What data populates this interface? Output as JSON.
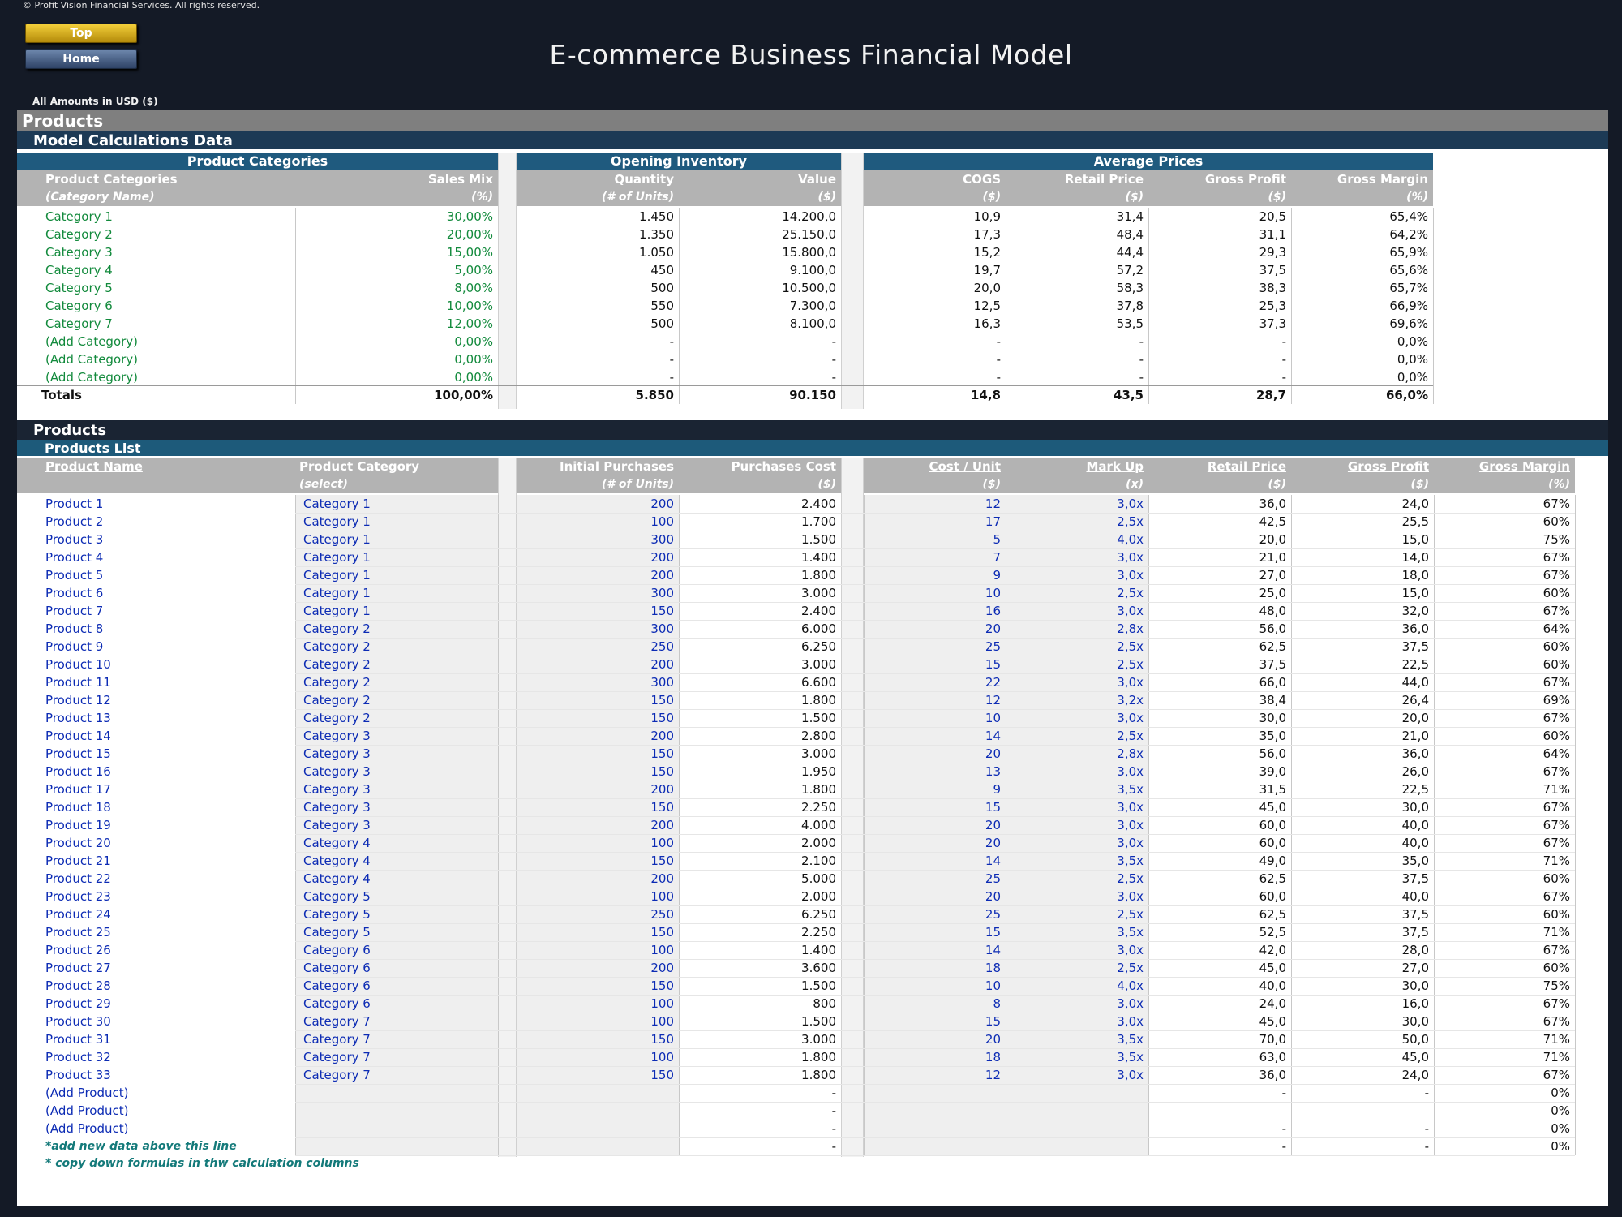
{
  "copyright": "© Profit Vision Financial Services. All rights reserved.",
  "nav": {
    "top_label": "Top",
    "home_label": "Home"
  },
  "page_title": "E-commerce Business Financial Model",
  "currency_note": "All Amounts in  USD ($)",
  "bands": {
    "products": "Products",
    "model_calc": "Model Calculations Data",
    "products2": "Products",
    "products_list": "Products List"
  },
  "calc_table": {
    "groups": [
      "Product Categories",
      "Opening Inventory",
      "Average Prices"
    ],
    "headers": [
      {
        "h1": "Product Categories",
        "h2": "(Category Name)"
      },
      {
        "h1": "Sales Mix",
        "h2": "(%)"
      },
      {
        "h1": "Quantity",
        "h2": "(# of Units)"
      },
      {
        "h1": "Value",
        "h2": "($)"
      },
      {
        "h1": "COGS",
        "h2": "($)"
      },
      {
        "h1": "Retail Price",
        "h2": "($)"
      },
      {
        "h1": "Gross Profit",
        "h2": "($)"
      },
      {
        "h1": "Gross Margin",
        "h2": "(%)"
      }
    ],
    "rows": [
      [
        "Category 1",
        "30,00%",
        "1.450",
        "14.200,0",
        "10,9",
        "31,4",
        "20,5",
        "65,4%"
      ],
      [
        "Category 2",
        "20,00%",
        "1.350",
        "25.150,0",
        "17,3",
        "48,4",
        "31,1",
        "64,2%"
      ],
      [
        "Category 3",
        "15,00%",
        "1.050",
        "15.800,0",
        "15,2",
        "44,4",
        "29,3",
        "65,9%"
      ],
      [
        "Category 4",
        "5,00%",
        "450",
        "9.100,0",
        "19,7",
        "57,2",
        "37,5",
        "65,6%"
      ],
      [
        "Category 5",
        "8,00%",
        "500",
        "10.500,0",
        "20,0",
        "58,3",
        "38,3",
        "65,7%"
      ],
      [
        "Category 6",
        "10,00%",
        "550",
        "7.300,0",
        "12,5",
        "37,8",
        "25,3",
        "66,9%"
      ],
      [
        "Category 7",
        "12,00%",
        "500",
        "8.100,0",
        "16,3",
        "53,5",
        "37,3",
        "69,6%"
      ],
      [
        "(Add Category)",
        "0,00%",
        "-",
        "-",
        "-",
        "-",
        "-",
        "0,0%"
      ],
      [
        "(Add Category)",
        "0,00%",
        "-",
        "-",
        "-",
        "-",
        "-",
        "0,0%"
      ],
      [
        "(Add Category)",
        "0,00%",
        "-",
        "-",
        "-",
        "-",
        "-",
        "0,0%"
      ]
    ],
    "totals": [
      "Totals",
      "100,00%",
      "5.850",
      "90.150",
      "14,8",
      "43,5",
      "28,7",
      "66,0%"
    ]
  },
  "products_table": {
    "headers": [
      {
        "h1": "Product Name",
        "h2": ""
      },
      {
        "h1": "Product Category",
        "h2": "(select)"
      },
      {
        "h1": "Initial Purchases",
        "h2": "(# of Units)"
      },
      {
        "h1": "Purchases Cost",
        "h2": "($)"
      },
      {
        "h1": "Cost / Unit",
        "h2": "($)"
      },
      {
        "h1": "Mark Up",
        "h2": "(x)"
      },
      {
        "h1": "Retail Price",
        "h2": "($)"
      },
      {
        "h1": "Gross Profit",
        "h2": "($)"
      },
      {
        "h1": "Gross Margin",
        "h2": "(%)"
      }
    ],
    "rows": [
      [
        "Product 1",
        "Category 1",
        "200",
        "2.400",
        "12",
        "3,0x",
        "36,0",
        "24,0",
        "67%"
      ],
      [
        "Product 2",
        "Category 1",
        "100",
        "1.700",
        "17",
        "2,5x",
        "42,5",
        "25,5",
        "60%"
      ],
      [
        "Product 3",
        "Category 1",
        "300",
        "1.500",
        "5",
        "4,0x",
        "20,0",
        "15,0",
        "75%"
      ],
      [
        "Product 4",
        "Category 1",
        "200",
        "1.400",
        "7",
        "3,0x",
        "21,0",
        "14,0",
        "67%"
      ],
      [
        "Product 5",
        "Category 1",
        "200",
        "1.800",
        "9",
        "3,0x",
        "27,0",
        "18,0",
        "67%"
      ],
      [
        "Product 6",
        "Category 1",
        "300",
        "3.000",
        "10",
        "2,5x",
        "25,0",
        "15,0",
        "60%"
      ],
      [
        "Product 7",
        "Category 1",
        "150",
        "2.400",
        "16",
        "3,0x",
        "48,0",
        "32,0",
        "67%"
      ],
      [
        "Product 8",
        "Category 2",
        "300",
        "6.000",
        "20",
        "2,8x",
        "56,0",
        "36,0",
        "64%"
      ],
      [
        "Product 9",
        "Category 2",
        "250",
        "6.250",
        "25",
        "2,5x",
        "62,5",
        "37,5",
        "60%"
      ],
      [
        "Product 10",
        "Category 2",
        "200",
        "3.000",
        "15",
        "2,5x",
        "37,5",
        "22,5",
        "60%"
      ],
      [
        "Product 11",
        "Category 2",
        "300",
        "6.600",
        "22",
        "3,0x",
        "66,0",
        "44,0",
        "67%"
      ],
      [
        "Product 12",
        "Category 2",
        "150",
        "1.800",
        "12",
        "3,2x",
        "38,4",
        "26,4",
        "69%"
      ],
      [
        "Product 13",
        "Category 2",
        "150",
        "1.500",
        "10",
        "3,0x",
        "30,0",
        "20,0",
        "67%"
      ],
      [
        "Product 14",
        "Category 3",
        "200",
        "2.800",
        "14",
        "2,5x",
        "35,0",
        "21,0",
        "60%"
      ],
      [
        "Product 15",
        "Category 3",
        "150",
        "3.000",
        "20",
        "2,8x",
        "56,0",
        "36,0",
        "64%"
      ],
      [
        "Product 16",
        "Category 3",
        "150",
        "1.950",
        "13",
        "3,0x",
        "39,0",
        "26,0",
        "67%"
      ],
      [
        "Product 17",
        "Category 3",
        "200",
        "1.800",
        "9",
        "3,5x",
        "31,5",
        "22,5",
        "71%"
      ],
      [
        "Product 18",
        "Category 3",
        "150",
        "2.250",
        "15",
        "3,0x",
        "45,0",
        "30,0",
        "67%"
      ],
      [
        "Product 19",
        "Category 3",
        "200",
        "4.000",
        "20",
        "3,0x",
        "60,0",
        "40,0",
        "67%"
      ],
      [
        "Product 20",
        "Category 4",
        "100",
        "2.000",
        "20",
        "3,0x",
        "60,0",
        "40,0",
        "67%"
      ],
      [
        "Product 21",
        "Category 4",
        "150",
        "2.100",
        "14",
        "3,5x",
        "49,0",
        "35,0",
        "71%"
      ],
      [
        "Product 22",
        "Category 4",
        "200",
        "5.000",
        "25",
        "2,5x",
        "62,5",
        "37,5",
        "60%"
      ],
      [
        "Product 23",
        "Category 5",
        "100",
        "2.000",
        "20",
        "3,0x",
        "60,0",
        "40,0",
        "67%"
      ],
      [
        "Product 24",
        "Category 5",
        "250",
        "6.250",
        "25",
        "2,5x",
        "62,5",
        "37,5",
        "60%"
      ],
      [
        "Product 25",
        "Category 5",
        "150",
        "2.250",
        "15",
        "3,5x",
        "52,5",
        "37,5",
        "71%"
      ],
      [
        "Product 26",
        "Category 6",
        "100",
        "1.400",
        "14",
        "3,0x",
        "42,0",
        "28,0",
        "67%"
      ],
      [
        "Product 27",
        "Category 6",
        "200",
        "3.600",
        "18",
        "2,5x",
        "45,0",
        "27,0",
        "60%"
      ],
      [
        "Product 28",
        "Category 6",
        "150",
        "1.500",
        "10",
        "4,0x",
        "40,0",
        "30,0",
        "75%"
      ],
      [
        "Product 29",
        "Category 6",
        "100",
        "800",
        "8",
        "3,0x",
        "24,0",
        "16,0",
        "67%"
      ],
      [
        "Product 30",
        "Category 7",
        "100",
        "1.500",
        "15",
        "3,0x",
        "45,0",
        "30,0",
        "67%"
      ],
      [
        "Product 31",
        "Category 7",
        "150",
        "3.000",
        "20",
        "3,5x",
        "70,0",
        "50,0",
        "71%"
      ],
      [
        "Product 32",
        "Category 7",
        "100",
        "1.800",
        "18",
        "3,5x",
        "63,0",
        "45,0",
        "71%"
      ],
      [
        "Product 33",
        "Category 7",
        "150",
        "1.800",
        "12",
        "3,0x",
        "36,0",
        "24,0",
        "67%"
      ],
      [
        "(Add Product)",
        "",
        "",
        "-",
        "",
        "",
        "-",
        "-",
        "0%"
      ],
      [
        "(Add Product)",
        "",
        "",
        "-",
        "",
        "",
        "",
        "",
        "0%"
      ],
      [
        "(Add Product)",
        "",
        "",
        "-",
        "",
        "",
        "-",
        "-",
        "0%"
      ],
      [
        "*add new data above this line",
        "",
        "",
        "-",
        "",
        "",
        "-",
        "-",
        "0%"
      ]
    ],
    "footnote": "* copy down formulas in thw calculation columns"
  }
}
